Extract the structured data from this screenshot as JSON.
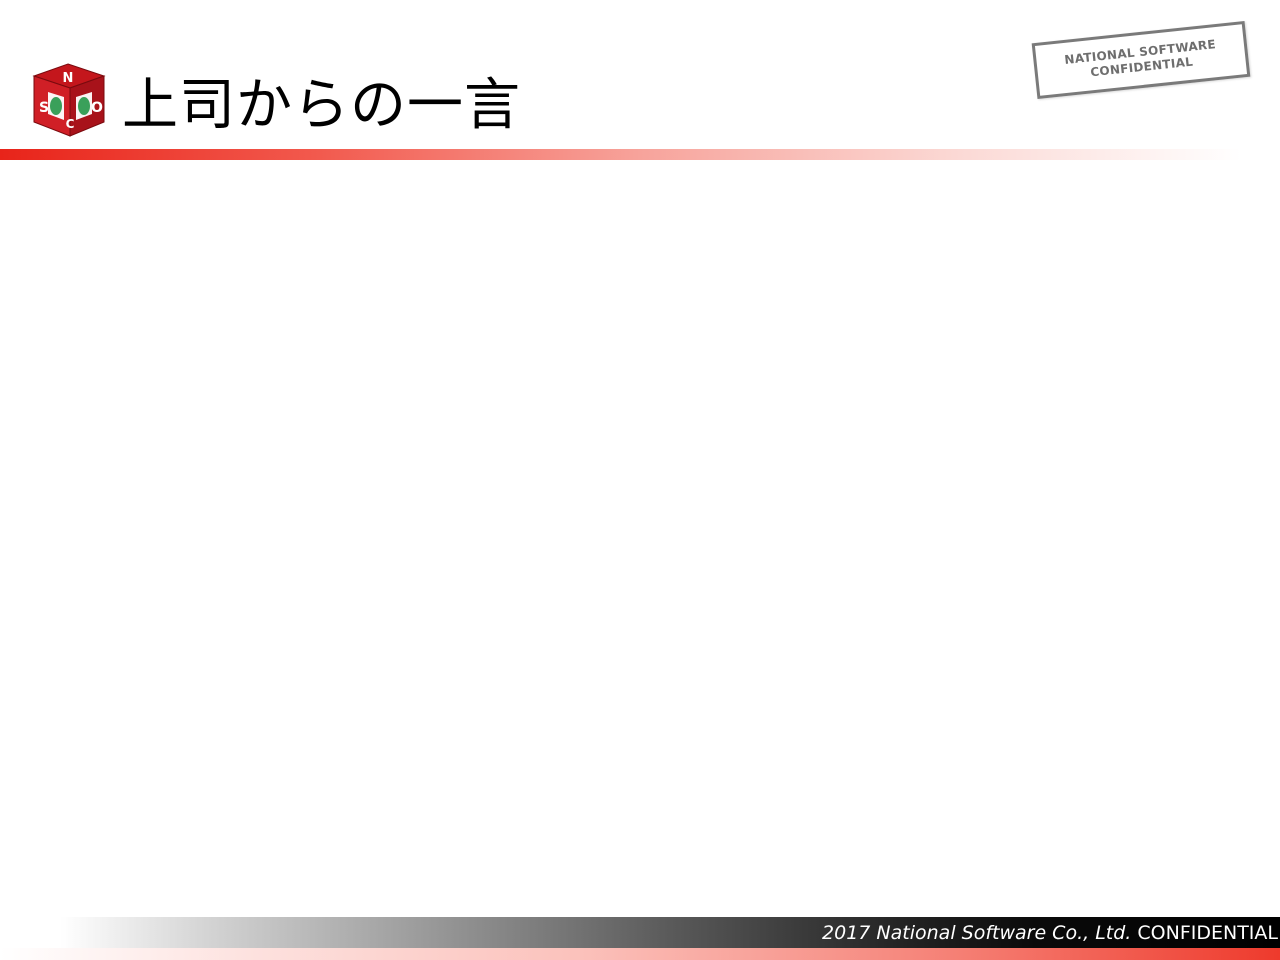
{
  "slide": {
    "title": "上司からの一言"
  },
  "stamp": {
    "line1": "NATIONAL SOFTWARE",
    "line2": "CONFIDENTIAL"
  },
  "logo": {
    "icon": "nsco-cube-logo",
    "letters": [
      "N",
      "S",
      "C",
      "O"
    ],
    "colors": {
      "red": "#c4161c",
      "green": "#3aa05a",
      "white": "#ffffff"
    }
  },
  "footer": {
    "company_text": "2017 National Software Co., Ltd.",
    "confidential_text": "CONFIDENTIAL"
  },
  "colors": {
    "accent_red": "#e8241a",
    "stamp_gray": "#7a7a7a",
    "footer_black": "#000000"
  }
}
